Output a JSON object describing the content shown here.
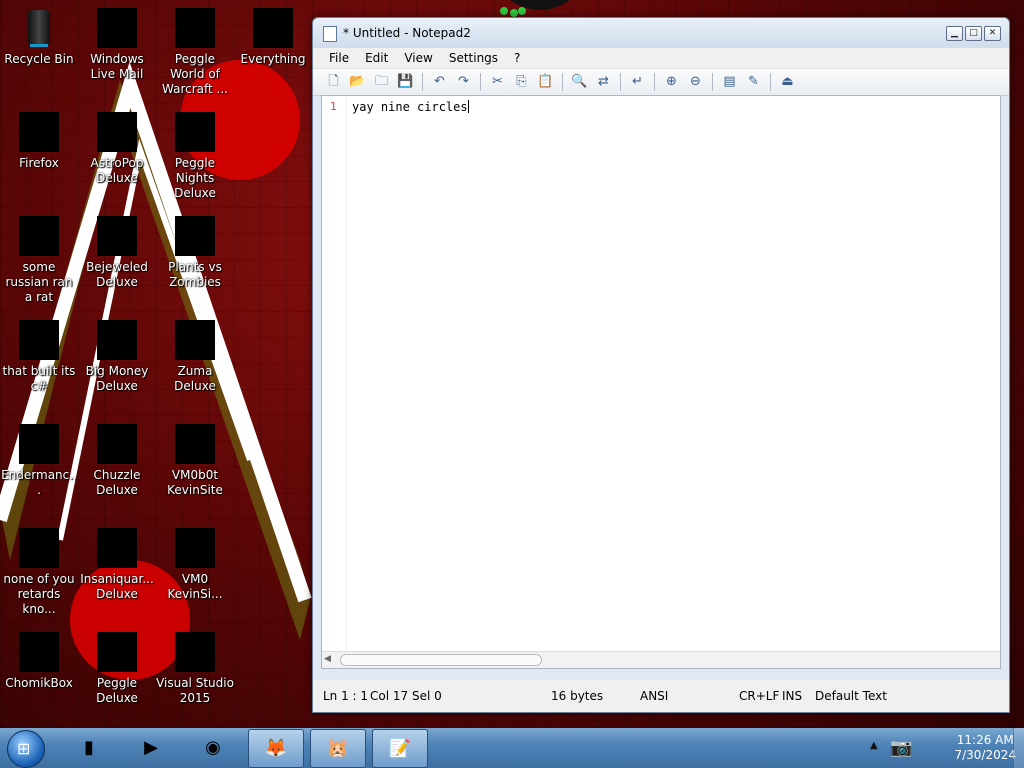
{
  "desktop": {
    "icons": [
      {
        "label": "Recycle Bin",
        "icon": "recycle-bin-icon"
      },
      {
        "label": "Windows Live Mail",
        "icon": "windows-live-mail-icon"
      },
      {
        "label": "Peggle World of Warcraft ...",
        "icon": "peggle-wow-icon"
      },
      {
        "label": "Everything",
        "icon": "everything-icon"
      },
      {
        "label": "Firefox",
        "icon": "firefox-icon"
      },
      {
        "label": "AstroPop Deluxe",
        "icon": "astropop-icon"
      },
      {
        "label": "Peggle Nights Deluxe",
        "icon": "peggle-nights-icon"
      },
      {
        "label": "some russian ran a rat",
        "icon": "java-app-icon"
      },
      {
        "label": "Bejeweled Deluxe",
        "icon": "bejeweled-icon"
      },
      {
        "label": "Plants vs Zombies",
        "icon": "pvz-icon"
      },
      {
        "label": "that built its c#",
        "icon": "shortcut-icon"
      },
      {
        "label": "Big Money Deluxe",
        "icon": "big-money-icon"
      },
      {
        "label": "Zuma Deluxe",
        "icon": "zuma-icon"
      },
      {
        "label": "Endermanc...",
        "icon": "terminal-app-icon"
      },
      {
        "label": "Chuzzle Deluxe",
        "icon": "chuzzle-icon"
      },
      {
        "label": "VM0b0t KevinSite",
        "icon": "vm-site-icon"
      },
      {
        "label": "none of you retards kno...",
        "icon": "chrome-like-icon"
      },
      {
        "label": "Insaniquar... Deluxe",
        "icon": "insaniquarium-icon"
      },
      {
        "label": "VM0 KevinSi...",
        "icon": "vm-site2-icon"
      },
      {
        "label": "ChomikBox",
        "icon": "chomikbox-icon"
      },
      {
        "label": "Peggle Deluxe",
        "icon": "peggle-icon"
      },
      {
        "label": "Visual Studio 2015",
        "icon": "visual-studio-icon"
      }
    ]
  },
  "notepad": {
    "title": "* Untitled - Notepad2",
    "menu": [
      "File",
      "Edit",
      "View",
      "Settings",
      "?"
    ],
    "toolbar": [
      "new-icon",
      "open-icon",
      "browse-icon",
      "save-icon",
      "undo-icon",
      "redo-icon",
      "cut-icon",
      "copy-icon",
      "paste-icon",
      "find-icon",
      "replace-icon",
      "wordwrap-icon",
      "zoom-in-icon",
      "zoom-out-icon",
      "scheme-icon",
      "customize-icon",
      "exit-icon"
    ],
    "line_number": "1",
    "text": "yay nine circles",
    "status": {
      "position": "Ln 1 : 1",
      "column": "Col 17",
      "selection": "Sel 0",
      "size": "16 bytes",
      "encoding": "ANSI",
      "line_endings": "CR+LF",
      "mode": "INS",
      "scheme": "Default Text"
    }
  },
  "taskbar": {
    "apps": [
      "media-player-icon",
      "media-center-icon",
      "globe-icon",
      "firefox-icon",
      "chomikbox-icon",
      "notepad2-icon"
    ],
    "time": "11:26 AM",
    "date": "7/30/2024"
  }
}
